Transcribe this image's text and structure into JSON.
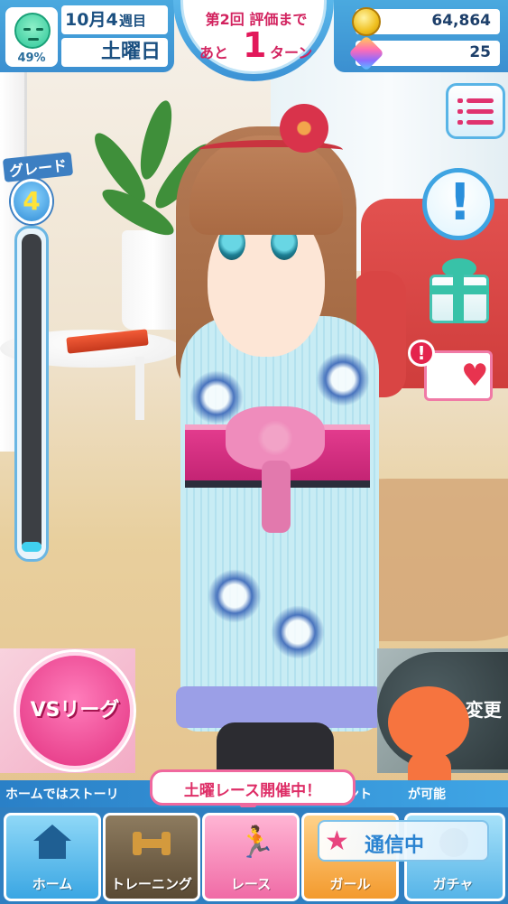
{
  "status": {
    "mood_percent": "49%",
    "date_main": "10月4",
    "date_week": "週目",
    "day_of_week": "土曜日",
    "mood_icon": "smiley-face-icon"
  },
  "evaluation": {
    "title": "第2回 評価まで",
    "prefix": "あと",
    "turns": "1",
    "unit": "ターン"
  },
  "resources": {
    "coins": "64,864",
    "gems": "25",
    "coin_icon": "gold-coin-icon",
    "gem_icon": "rainbow-gem-icon"
  },
  "grade": {
    "label": "グレード",
    "value": "4",
    "progress": 0.03
  },
  "side_buttons": {
    "info": "!",
    "diary_alert": "!"
  },
  "vs_league": {
    "label": "VSリーグ"
  },
  "gacha_change": {
    "label": "ガチャ変更"
  },
  "ticker": {
    "left": "ホームではストーリ",
    "mid": "ゼント",
    "right": "が可能"
  },
  "balloon": {
    "text": "土曜レース開催中！"
  },
  "comm": {
    "label": "通信中"
  },
  "nav": {
    "home": "ホーム",
    "training": "トレーニング",
    "race": "レース",
    "girl": "ガール",
    "gacha": "ガチャ"
  },
  "colors": {
    "hud_blue": "#3b8fd0",
    "accent_pink": "#e2307f",
    "gauge_fill": "#40d0ef"
  }
}
